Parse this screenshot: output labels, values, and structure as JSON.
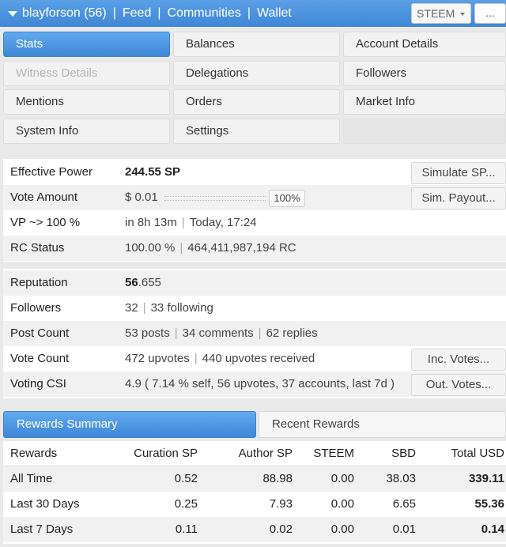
{
  "header": {
    "user": "blayforson (56)",
    "nav": [
      "Feed",
      "Communities",
      "Wallet"
    ],
    "token_select": "STEEM",
    "more_label": "..."
  },
  "menu": {
    "items": [
      {
        "label": "Stats",
        "state": "active"
      },
      {
        "label": "Balances",
        "state": "normal"
      },
      {
        "label": "Account Details",
        "state": "normal"
      },
      {
        "label": "Witness Details",
        "state": "disabled"
      },
      {
        "label": "Delegations",
        "state": "normal"
      },
      {
        "label": "Followers",
        "state": "normal"
      },
      {
        "label": "Mentions",
        "state": "normal"
      },
      {
        "label": "Orders",
        "state": "normal"
      },
      {
        "label": "Market Info",
        "state": "normal"
      },
      {
        "label": "System Info",
        "state": "normal"
      },
      {
        "label": "Settings",
        "state": "normal"
      }
    ]
  },
  "stats": {
    "effective_power": {
      "label": "Effective Power",
      "value": "244.55 SP",
      "button": "Simulate SP..."
    },
    "vote_amount": {
      "label": "Vote Amount",
      "value": "$ 0.01",
      "percent": "100%",
      "button": "Sim. Payout..."
    },
    "vp": {
      "label": "VP ~> 100 %",
      "time": "in 8h 13m",
      "when": "Today, 17:24"
    },
    "rc": {
      "label": "RC Status",
      "percent": "100.00 %",
      "amount": "464,411,987,194 RC"
    }
  },
  "profile": {
    "reputation": {
      "label": "Reputation",
      "whole": "56",
      "decimal": ".655"
    },
    "followers": {
      "label": "Followers",
      "count": "32",
      "following": "33 following"
    },
    "post_count": {
      "label": "Post Count",
      "posts": "53 posts",
      "comments": "34 comments",
      "replies": "62 replies"
    },
    "vote_count": {
      "label": "Vote Count",
      "upvotes": "472 upvotes",
      "received": "440 upvotes received",
      "button": "Inc. Votes..."
    },
    "voting_csi": {
      "label": "Voting CSI",
      "value": "4.9 ( 7.14 % self, 56 upvotes, 37 accounts, last 7d )",
      "button": "Out. Votes..."
    }
  },
  "rewards": {
    "tabs": [
      "Rewards Summary",
      "Recent Rewards"
    ],
    "columns": [
      "Rewards",
      "Curation SP",
      "Author SP",
      "STEEM",
      "SBD",
      "Total USD"
    ],
    "rows": [
      [
        "All Time",
        "0.52",
        "88.98",
        "0.00",
        "38.03",
        "339.11"
      ],
      [
        "Last 30 Days",
        "0.25",
        "7.93",
        "0.00",
        "6.65",
        "55.36"
      ],
      [
        "Last 7 Days",
        "0.11",
        "0.02",
        "0.00",
        "0.01",
        "0.14"
      ]
    ]
  }
}
